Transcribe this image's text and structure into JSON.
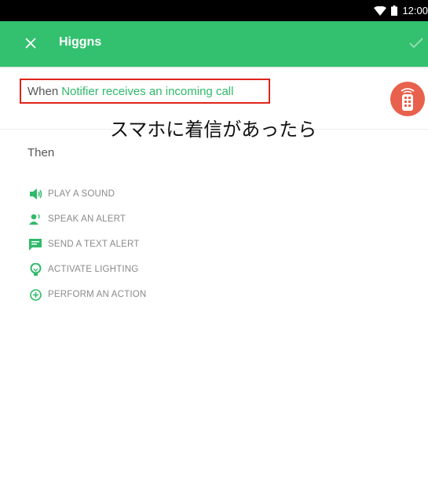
{
  "status_bar": {
    "time": "12:00"
  },
  "app_bar": {
    "title": "Higgns",
    "close_icon": "close-icon",
    "confirm_icon": "check-icon"
  },
  "trigger": {
    "when_label": "When",
    "trigger_text": "Notifier receives an incoming call",
    "device_icon": "remote-device-icon"
  },
  "annotation": {
    "caption": "スマホに着信があったら"
  },
  "actions": {
    "then_label": "Then",
    "items": [
      {
        "label": "PLAY A SOUND",
        "icon": "speaker-icon"
      },
      {
        "label": "SPEAK AN ALERT",
        "icon": "speak-person-icon"
      },
      {
        "label": "SEND A TEXT ALERT",
        "icon": "message-icon"
      },
      {
        "label": "ACTIVATE LIGHTING",
        "icon": "lightbulb-icon"
      },
      {
        "label": "PERFORM AN ACTION",
        "icon": "plus-circle-icon"
      }
    ]
  },
  "colors": {
    "accent": "#33c06f",
    "highlight_border": "#e0241b",
    "device_badge": "#e8614d"
  }
}
